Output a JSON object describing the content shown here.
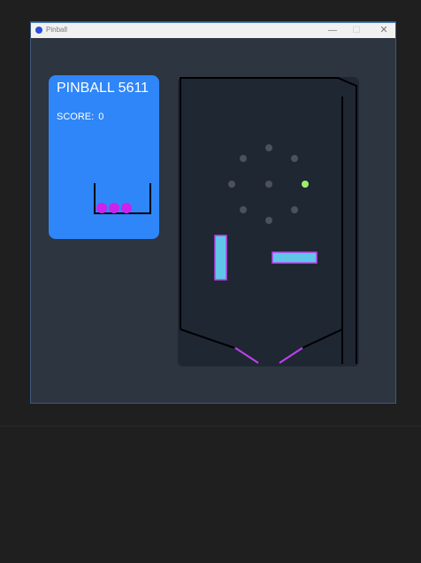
{
  "window": {
    "title": "Pinball",
    "minimize_label": "—",
    "maximize_label": "☐",
    "close_label": "✕"
  },
  "panel": {
    "title": "PINBALL 5611",
    "score_label": "SCORE:",
    "score_value": "0",
    "balls_remaining": 3
  },
  "board": {
    "bumpers": 9,
    "active_ball": "green"
  },
  "colors": {
    "desktop": "#1f1f1f",
    "window_bg": "#2d3540",
    "panel": "#2f86f8",
    "board": "#1f2733",
    "ball": "#cc22ee",
    "paddle_fill": "#5fc6e8",
    "paddle_border": "#c040f0",
    "bumper": "#4b525c",
    "active_ball": "#9cf06a",
    "flipper": "#c040f0"
  }
}
